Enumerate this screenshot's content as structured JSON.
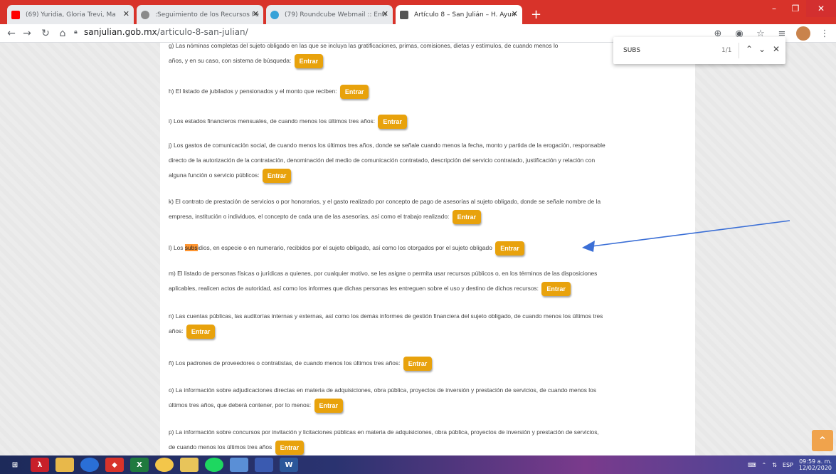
{
  "tabs": [
    {
      "label": "(69) Yuridia, Gloria Trevi, Ma",
      "favicon_color": "#ff0000"
    },
    {
      "label": ":Seguimiento de los Recursos Fe",
      "favicon_color": "#8a8a8a"
    },
    {
      "label": "(79) Roundcube Webmail :: Entr",
      "favicon_color": "#37a2d8"
    },
    {
      "label": "Artículo 8 – San Julián – H. Ayun",
      "favicon_color": "#555555"
    }
  ],
  "new_tab": "+",
  "url": {
    "host": "sanjulian.gob.mx",
    "path": "/articulo-8-san-julian/"
  },
  "find": {
    "query": "SUBS",
    "count": "1/1"
  },
  "button_label": "Entrar",
  "paragraphs": {
    "g1": "g) Las nóminas completas del sujeto obligado en las que se incluya las gratificaciones, primas, comisiones, dietas y estímulos, de cuando menos lo",
    "g2": "años, y en su caso, con sistema de búsqueda:",
    "h": "h) El listado de jubilados y pensionados y el monto que reciben:",
    "i": "i) Los estados financieros mensuales, de cuando menos los últimos tres años:",
    "j1": "j) Los gastos de comunicación social, de cuando menos los últimos tres años, donde se señale cuando menos la fecha, monto y partida de la erogación, responsable",
    "j2": "directo de la autorización de la contratación, denominación del medio de comunicación contratado, descripción del servicio contratado, justificación y relación con",
    "j3": "alguna función o servicio públicos:",
    "k1": "k) El contrato de prestación de servicios o por honorarios, y el gasto realizado por concepto de pago de asesorías al sujeto obligado, donde se señale nombre de la",
    "k2": "empresa, institución o individuos, el concepto de cada una de las asesorías, así como el trabajo realizado:",
    "l_pre": "l) Los ",
    "l_hl": "subs",
    "l_post": "idios, en especie o en numerario, recibidos por el sujeto obligado, así como los otorgados por el sujeto obligado",
    "m1": "m) El listado de personas físicas o jurídicas a quienes, por cualquier motivo, se les asigne o permita usar recursos públicos o, en los términos de las disposiciones",
    "m2": "aplicables, realicen actos de autoridad, así como los informes que dichas personas les entreguen sobre el uso y destino de dichos recursos:",
    "n1": "n) Las cuentas públicas, las auditorías internas y externas, así como los demás informes de gestión financiera del sujeto obligado, de cuando menos los últimos tres",
    "n2": "años:",
    "nn": "ñ) Los padrones de proveedores o contratistas, de cuando menos los últimos tres años:",
    "o1": "o) La información sobre adjudicaciones directas en materia de adquisiciones, obra pública, proyectos de inversión y prestación de servicios, de cuando menos los",
    "o2": "últimos tres años, que deberá contener, por lo menos:",
    "p1": "p) La información sobre concursos por invitación y licitaciones públicas en materia de adquisiciones, obra pública, proyectos de inversión y prestación de servicios,",
    "p2": "de cuando menos los últimos tres años"
  },
  "taskbar": {
    "lang": "ESP",
    "time": "09:59 a. m.",
    "date": "12/02/2020"
  },
  "colors": {
    "tabstrip": "#d8332a",
    "button": "#e8a20c",
    "highlight": "#ff9632",
    "arrow": "#3b6fd6"
  }
}
